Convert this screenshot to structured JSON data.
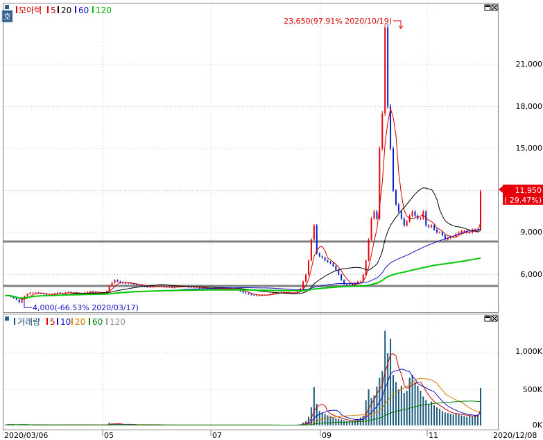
{
  "header": {
    "badge": "호",
    "price_legend": {
      "name": "모아텍",
      "ma5": "5",
      "ma20": "20",
      "ma60": "60",
      "ma120": "120"
    },
    "volume_legend": {
      "name": "거래량",
      "ma5": "5",
      "ma10": "10",
      "ma20": "20",
      "ma60": "60",
      "ma120": "120"
    }
  },
  "annotations": {
    "high": "23,650(97.91% 2020/10/19)",
    "low": "4,000(-66.53% 2020/03/17)",
    "last_price": "11,950",
    "last_change": "( 29.47%)"
  },
  "axis": {
    "price_ticks": [
      "21,000",
      "18,000",
      "15,000",
      "9,000",
      "6,000"
    ],
    "volume_ticks": [
      "1,000K",
      "500K",
      "0K"
    ],
    "date_labels": [
      "2020/03/06",
      "05",
      "07",
      "09",
      "11",
      "2020/12/08"
    ]
  },
  "colors": {
    "up": "#e8000b",
    "down": "#0a1fc8",
    "ma5": "#c80000",
    "ma20": "#000000",
    "ma60": "#1010c8",
    "ma120": "#00c800",
    "hline": "#808080",
    "text_red": "#d40000"
  },
  "chart_data": [
    {
      "type": "candlestick",
      "title": "모아텍",
      "x": [
        "2020/03/06",
        "2020/12/08"
      ],
      "ylim": [
        4000,
        23800
      ],
      "horizontal_lines": [
        8300,
        5300
      ],
      "series_closes": {
        "name": "모아텍",
        "values": [
          4500,
          4500,
          4400,
          4300,
          4200,
          4000,
          4300,
          4450,
          4600,
          4700,
          4700,
          4700,
          4650,
          4650,
          4600,
          4500,
          4550,
          4600,
          4650,
          4700,
          4650,
          4600,
          4700,
          4750,
          4700,
          4700,
          4650,
          4600,
          4650,
          4700,
          4750,
          4800,
          4750,
          4700,
          4700,
          4650,
          4700,
          4800,
          5200,
          5400,
          5600,
          5500,
          5400,
          5400,
          5350,
          5400,
          5350,
          5300,
          5250,
          5250,
          5200,
          5150,
          5100,
          5100,
          5150,
          5150,
          5150,
          5150,
          5100,
          5100,
          5100,
          5050,
          5100,
          5150,
          5150,
          5150,
          5150,
          5100,
          5100,
          5100,
          5100,
          5050,
          5050,
          5000,
          5000,
          4950,
          5000,
          5000,
          5000,
          5000,
          5000,
          5000,
          4950,
          4950,
          4900,
          4900,
          4800,
          4700,
          4650,
          4600,
          4550,
          4500,
          4500,
          4500,
          4550,
          4550,
          4550,
          4600,
          4650,
          4700,
          4700,
          4750,
          4700,
          4700,
          4650,
          4650,
          4700,
          4800,
          5000,
          5500,
          6000,
          7000,
          8500,
          9500,
          7500,
          7300,
          7200,
          7000,
          6900,
          6800,
          6600,
          6300,
          6000,
          5600,
          5300,
          5250,
          5300,
          5200,
          5400,
          5500,
          5500,
          6000,
          7000,
          8500,
          10000,
          10500,
          10000,
          15000,
          17500,
          23650,
          18000,
          15000,
          12000,
          11000,
          10500,
          10000,
          9500,
          9800,
          10200,
          10500,
          10200,
          10000,
          10000,
          10500,
          9500,
          9400,
          9500,
          9200,
          9000,
          9000,
          8800,
          8500,
          8600,
          8700,
          8700,
          8900,
          9000,
          9100,
          9100,
          9000,
          9000,
          9200,
          9200,
          9200,
          11950
        ]
      },
      "moving_averages": [
        "5",
        "20",
        "60",
        "120"
      ],
      "annotations": [
        "23,650(97.91% 2020/10/19)",
        "4,000(-66.53% 2020/03/17)",
        "11,950",
        "( 29.47%)"
      ]
    },
    {
      "type": "bar",
      "title": "거래량",
      "x": [
        "2020/03/06",
        "2020/12/08"
      ],
      "ylim": [
        0,
        1420000
      ],
      "series": [
        {
          "name": "거래량",
          "values": [
            10000,
            12000,
            11000,
            8000,
            9000,
            14000,
            10000,
            9000,
            8000,
            7000,
            6000,
            6000,
            5000,
            5000,
            5000,
            6000,
            5000,
            5000,
            6000,
            6000,
            5000,
            5000,
            7000,
            8000,
            9000,
            8000,
            6000,
            5000,
            5000,
            6000,
            7000,
            6000,
            5000,
            5000,
            5000,
            6000,
            7000,
            12000,
            40000,
            28000,
            22000,
            14000,
            10000,
            8000,
            7000,
            6000,
            6000,
            5000,
            5000,
            5000,
            5000,
            5000,
            5000,
            5000,
            5000,
            5000,
            5000,
            5000,
            5000,
            5000,
            5000,
            5000,
            5000,
            5000,
            5000,
            5000,
            5000,
            5000,
            5000,
            5000,
            5000,
            5000,
            5000,
            5000,
            5000,
            5000,
            5000,
            5000,
            5000,
            5000,
            5000,
            5000,
            5000,
            5000,
            5000,
            5000,
            5000,
            5000,
            5000,
            5000,
            5000,
            5000,
            5000,
            5000,
            5000,
            5000,
            5000,
            5000,
            5000,
            5000,
            5000,
            5000,
            5000,
            5000,
            5000,
            5000,
            5000,
            8000,
            15000,
            40000,
            60000,
            120000,
            250000,
            530000,
            300000,
            200000,
            180000,
            160000,
            140000,
            130000,
            110000,
            100000,
            90000,
            80000,
            70000,
            60000,
            60000,
            60000,
            70000,
            90000,
            110000,
            130000,
            350000,
            500000,
            380000,
            420000,
            540000,
            660000,
            750000,
            1310000,
            1000000,
            1200000,
            700000,
            600000,
            500000,
            550000,
            450000,
            480000,
            660000,
            700000,
            600000,
            550000,
            480000,
            400000,
            350000,
            300000,
            330000,
            280000,
            250000,
            230000,
            200000,
            180000,
            170000,
            160000,
            150000,
            160000,
            160000,
            140000,
            130000,
            120000,
            130000,
            120000,
            140000,
            150000,
            520000
          ]
        }
      ]
    }
  ]
}
